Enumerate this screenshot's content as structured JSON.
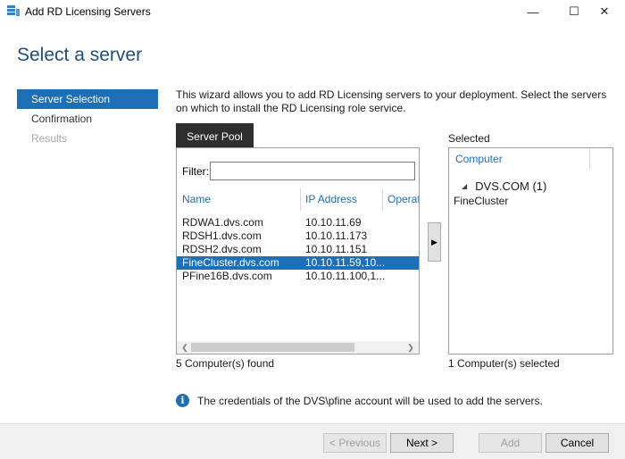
{
  "window": {
    "title": "Add RD Licensing Servers",
    "controls": {
      "minimize": "—",
      "maximize": "☐",
      "close": "✕"
    }
  },
  "wizard": {
    "heading": "Select a server",
    "steps": [
      {
        "label": "Server Selection",
        "state": "active"
      },
      {
        "label": "Confirmation",
        "state": "normal"
      },
      {
        "label": "Results",
        "state": "disabled"
      }
    ],
    "description": "This wizard allows you to add RD Licensing servers to your deployment. Select the servers on which to install the RD Licensing role service."
  },
  "server_pool": {
    "tab_label": "Server Pool",
    "filter_label": "Filter:",
    "filter_value": "",
    "columns": [
      "Name",
      "IP Address",
      "Operat"
    ],
    "rows": [
      {
        "name": "RDWA1.dvs.com",
        "ip": "10.10.11.69",
        "selected": false
      },
      {
        "name": "RDSH1.dvs.com",
        "ip": "10.10.11.173",
        "selected": false
      },
      {
        "name": "RDSH2.dvs.com",
        "ip": "10.10.11.151",
        "selected": false
      },
      {
        "name": "FineCluster.dvs.com",
        "ip": "10.10.11.59,10...",
        "selected": true
      },
      {
        "name": "PFine16B.dvs.com",
        "ip": "10.10.11.100,1...",
        "selected": false
      }
    ],
    "status": "5 Computer(s) found"
  },
  "add_arrow": "▶",
  "selected_panel": {
    "label": "Selected",
    "column": "Computer",
    "group": "DVS.COM (1)",
    "items": [
      "FineCluster"
    ],
    "status": "1 Computer(s) selected"
  },
  "info": {
    "icon": "i",
    "text": "The credentials of the DVS\\pfine account will be used to add the servers."
  },
  "buttons": {
    "previous": "< Previous",
    "next": "Next >",
    "add": "Add",
    "cancel": "Cancel"
  },
  "colors": {
    "accent": "#1e6fb5",
    "heading": "#1e4e79",
    "tab_background": "#2e2e2e",
    "footer": "#f0f0f0"
  }
}
